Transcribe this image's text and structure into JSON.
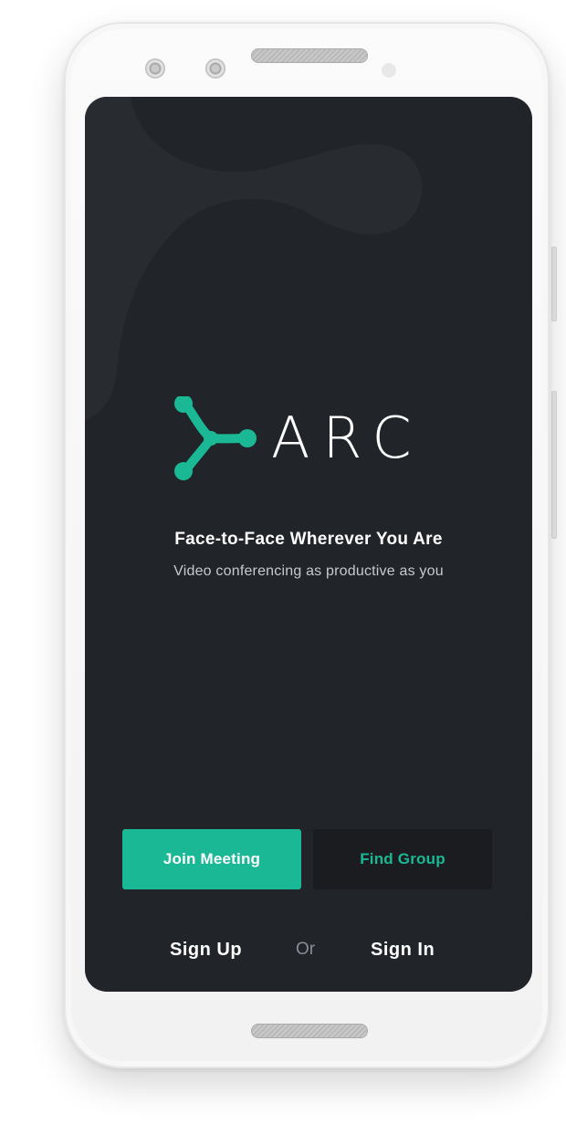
{
  "app": {
    "brand_name": "ARC",
    "tagline_title": "Face-to-Face Wherever You Are",
    "tagline_subtitle": "Video conferencing as productive as you"
  },
  "actions": {
    "join_meeting_label": "Join Meeting",
    "find_group_label": "Find Group",
    "sign_up_label": "Sign Up",
    "separator_label": "Or",
    "sign_in_label": "Sign In"
  },
  "colors": {
    "accent": "#1ab895",
    "screen_background": "#212429",
    "secondary_button": "#1a1c20",
    "muted_text": "#8b8e94"
  },
  "icons": {
    "brand_mark": "arc-logo-icon"
  }
}
